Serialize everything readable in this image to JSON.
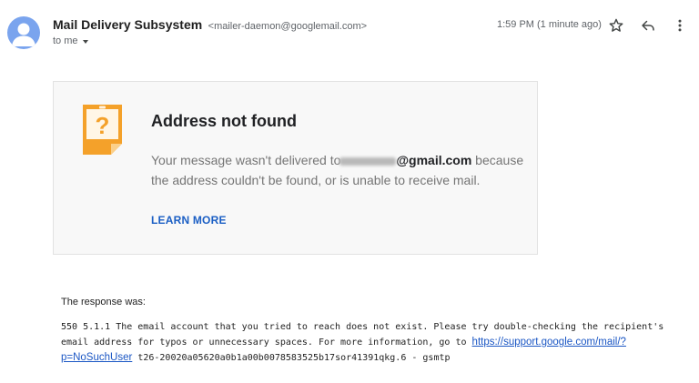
{
  "header": {
    "sender_name": "Mail Delivery Subsystem",
    "sender_email": "<mailer-daemon@googlemail.com>",
    "recipient": "to me",
    "timestamp": "1:59 PM (1 minute ago)"
  },
  "icons": {
    "avatar": "person-avatar-icon",
    "recipient_toggle": "chevron-down-icon",
    "star": "star-icon",
    "reply": "reply-icon",
    "more": "more-vert-icon",
    "warning": "question-note-icon"
  },
  "colors": {
    "avatar_bg": "#7aa4ee",
    "note_orange": "#f4a12a",
    "link_blue": "#1a5ec4"
  },
  "card": {
    "title": "Address not found",
    "message_before": "Your message wasn't delivered to",
    "address_visible": "@gmail.com",
    "message_after": " because the address couldn't be found, or is unable to receive mail.",
    "learn_more": "LEARN MORE"
  },
  "response": {
    "label": "The response was:",
    "text_before_link": "550 5.1.1 The email account that you tried to reach does not exist. Please try double-checking the recipient's email address for typos or unnecessary spaces. For more information, go to ",
    "link_text": "https://support.google.com/mail/?p=NoSuchUser",
    "text_after_link": " t26-20020a05620a0b1a00b0078583525b17sor41391qkg.6 - gsmtp"
  }
}
